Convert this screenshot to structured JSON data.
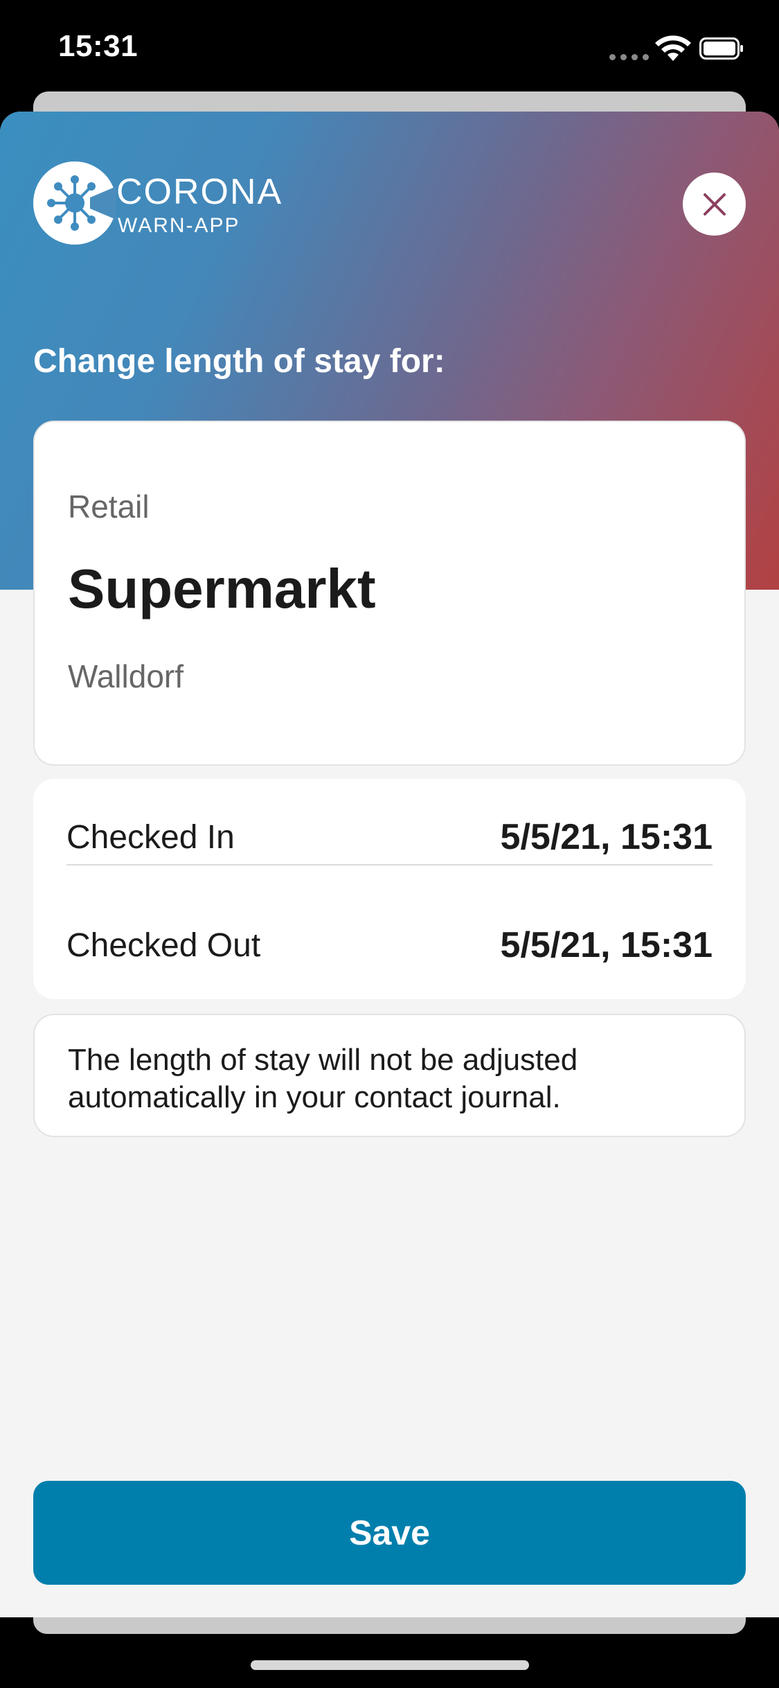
{
  "status_bar": {
    "time": "15:31"
  },
  "brand": {
    "title": "CORONA",
    "subtitle": "WARN-APP"
  },
  "heading": "Change length of stay for:",
  "location": {
    "type": "Retail",
    "name": "Supermarkt",
    "city": "Walldorf"
  },
  "times": {
    "checked_in_label": "Checked In",
    "checked_in_value": "5/5/21, 15:31",
    "checked_out_label": "Checked Out",
    "checked_out_value": "5/5/21, 15:31"
  },
  "note": "The length of stay will not be adjusted automatically in your contact journal.",
  "save_label": "Save",
  "colors": {
    "accent": "#007fad",
    "gradient_start": "#3a8fc0",
    "gradient_end": "#b24142",
    "close_icon": "#8b3f5f"
  },
  "icons": [
    "wifi-icon",
    "battery-icon",
    "close-icon",
    "corona-logo-icon"
  ]
}
